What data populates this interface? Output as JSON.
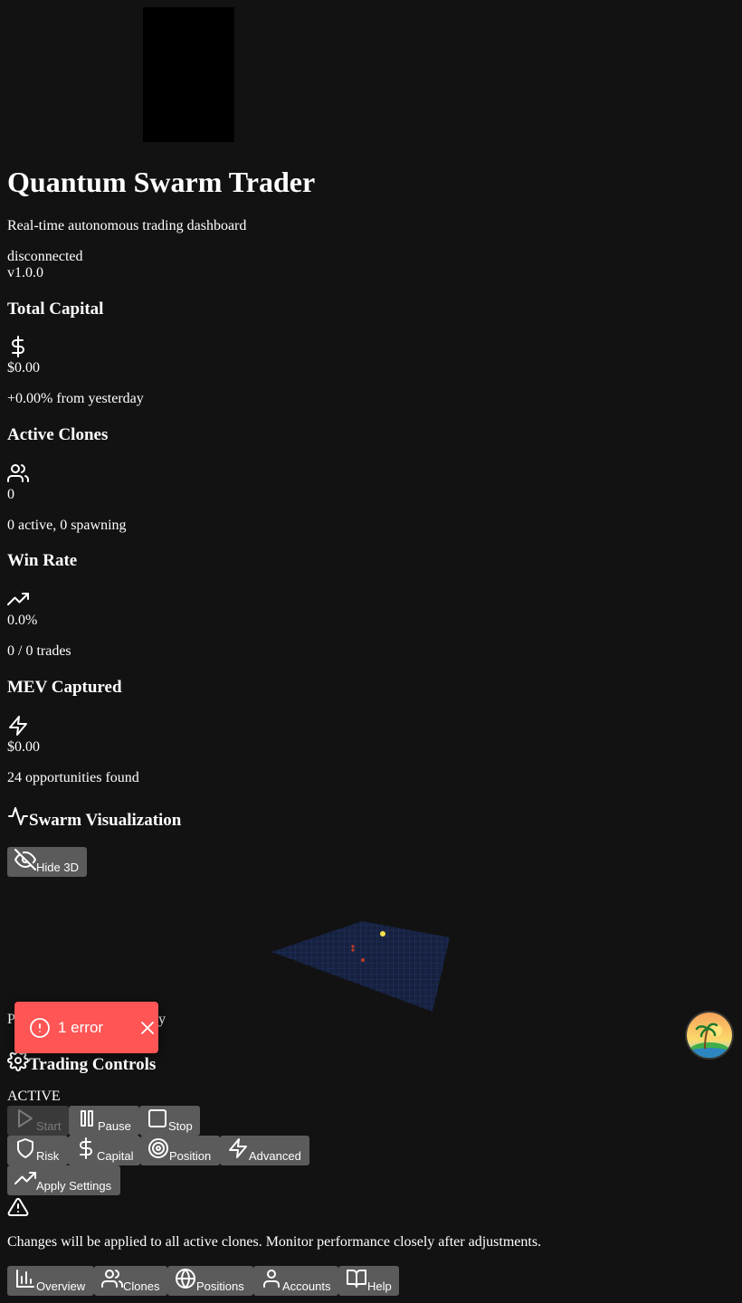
{
  "header": {
    "title": "Quantum Swarm Trader",
    "subtitle": "Real-time autonomous trading dashboard",
    "connection_status": "disconnected",
    "version": "v1.0.0"
  },
  "stats": {
    "capital": {
      "title": "Total Capital",
      "icon": "dollar-icon",
      "value": "$0.00",
      "detail": "+0.00% from yesterday"
    },
    "clones": {
      "title": "Active Clones",
      "icon": "users-icon",
      "value": "0",
      "detail": "0 active, 0 spawning"
    },
    "win_rate": {
      "title": "Win Rate",
      "icon": "trending-up-icon",
      "value": "0.0%",
      "detail": "0 / 0 trades"
    },
    "mev": {
      "title": "MEV Captured",
      "icon": "zap-icon",
      "value": "$0.00",
      "detail": "24 opportunities found"
    }
  },
  "swarm": {
    "title": "Swarm Visualization",
    "toggle_label": "Hide 3D",
    "caption_start": "P",
    "caption_end": "y"
  },
  "controls": {
    "title": "Trading Controls",
    "status": "ACTIVE",
    "start_label": "Start",
    "pause_label": "Pause",
    "stop_label": "Stop",
    "risk_label": "Risk",
    "capital_label": "Capital",
    "position_label": "Position",
    "advanced_label": "Advanced",
    "apply_label": "Apply Settings",
    "warning_text": "Changes will be applied to all active clones. Monitor performance closely after adjustments."
  },
  "nav": {
    "overview": "Overview",
    "clones": "Clones",
    "positions": "Positions",
    "accounts": "Accounts",
    "help": "Help"
  },
  "toast": {
    "text": "1 error",
    "color": "#ff5555"
  },
  "colors": {
    "background": "#121212",
    "button": "#5b5b5b",
    "grid": "#1f2d5c"
  }
}
